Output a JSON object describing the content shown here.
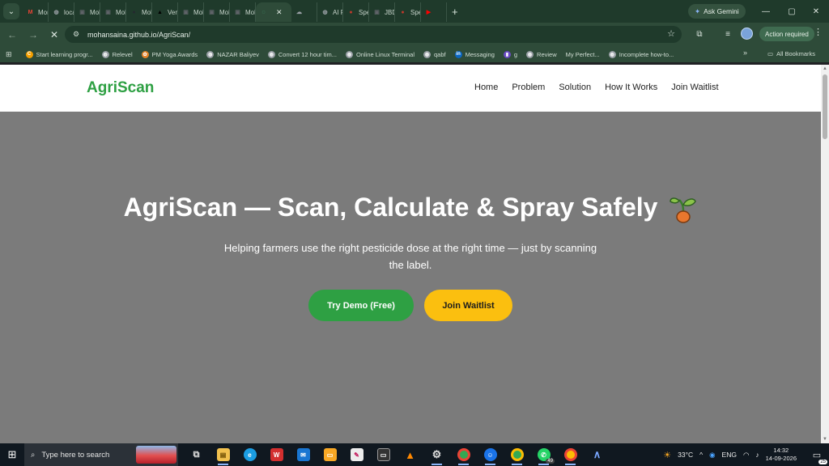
{
  "browser": {
    "tabs": [
      {
        "label": "Mon",
        "icon": "gmail-icon",
        "color": "#ea4335",
        "glyph": "M"
      },
      {
        "label": "loca",
        "icon": "globe-icon",
        "color": "#9aa0a6",
        "glyph": "◍"
      },
      {
        "label": "Moh",
        "icon": "page-icon",
        "color": "#5f6368",
        "glyph": "▣"
      },
      {
        "label": "Moh",
        "icon": "page-icon",
        "color": "#5f6368",
        "glyph": "▣"
      },
      {
        "label": "Moh",
        "icon": "github-icon",
        "color": "#24292f",
        "glyph": "●"
      },
      {
        "label": "Verc",
        "icon": "vercel-icon",
        "color": "#000000",
        "glyph": "▲"
      },
      {
        "label": "Moh",
        "icon": "page-icon",
        "color": "#5f6368",
        "glyph": "▣"
      },
      {
        "label": "Moh",
        "icon": "page-icon",
        "color": "#5f6368",
        "glyph": "▣"
      },
      {
        "label": "Moh",
        "icon": "page-icon",
        "color": "#5f6368",
        "glyph": "▣"
      },
      {
        "label": "",
        "icon": "loading-icon",
        "color": "#4caf7d",
        "glyph": "◌",
        "active": true
      },
      {
        "label": "",
        "icon": "cloud-icon",
        "color": "#9aa0a6",
        "glyph": "☁"
      },
      {
        "label": "AI Re",
        "icon": "globe-icon",
        "color": "#9aa0a6",
        "glyph": "◍"
      },
      {
        "label": "Spe",
        "icon": "avatar-icon",
        "color": "#c0392b",
        "glyph": "●"
      },
      {
        "label": "JBD",
        "icon": "page-icon",
        "color": "#5f6368",
        "glyph": "▣"
      },
      {
        "label": "Spe",
        "icon": "avatar-icon",
        "color": "#c0392b",
        "glyph": "●"
      },
      {
        "label": "",
        "icon": "youtube-icon",
        "color": "#ff0000",
        "glyph": "▶"
      }
    ],
    "gemini_label": "Ask Gemini",
    "url": "mohansaina.github.io/AgriScan/",
    "action_required": "Action required",
    "bookmarks": [
      {
        "label": "Start learning progr...",
        "color": "#f4a000",
        "glyph": "C"
      },
      {
        "label": "Relevel",
        "color": "#9aa0a6",
        "glyph": "◍"
      },
      {
        "label": "PM Yoga Awards",
        "color": "#e2842a",
        "glyph": "✿"
      },
      {
        "label": "NAZAR Baliyev",
        "color": "#9aa0a6",
        "glyph": "◍"
      },
      {
        "label": "Convert 12 hour tim...",
        "color": "#9aa0a6",
        "glyph": "◍"
      },
      {
        "label": "Online Linux Terminal",
        "color": "#9aa0a6",
        "glyph": "◍"
      },
      {
        "label": "qabf",
        "color": "#9aa0a6",
        "glyph": "◍"
      },
      {
        "label": "Messaging",
        "color": "#0a66c2",
        "glyph": "in"
      },
      {
        "label": "g",
        "color": "#6a4bc4",
        "glyph": "▮"
      },
      {
        "label": "Review",
        "color": "#9aa0a6",
        "glyph": "◍"
      },
      {
        "label": "My Perfect...",
        "color": "",
        "glyph": ""
      },
      {
        "label": "Incomplete how-to...",
        "color": "#9aa0a6",
        "glyph": "◍"
      }
    ],
    "all_bookmarks": "All Bookmarks"
  },
  "site": {
    "logo": "AgriScan",
    "nav": [
      "Home",
      "Problem",
      "Solution",
      "How It Works",
      "Join Waitlist"
    ],
    "hero_title": "AgriScan — Scan, Calculate & Spray Safely",
    "hero_subtitle": "Helping farmers use the right pesticide dose at the right time — just by scanning the label.",
    "btn_demo": "Try Demo (Free)",
    "btn_waitlist": "Join Waitlist",
    "colors": {
      "brand": "#2ea043",
      "accent": "#fbbf0f",
      "hero_bg": "#7b7b7b"
    }
  },
  "taskbar": {
    "search_placeholder": "Type here to search",
    "whatsapp_badge": "49",
    "temperature": "33°C",
    "language": "ENG",
    "time": "14:32",
    "date": "14-09-2026",
    "notifications": "25"
  }
}
